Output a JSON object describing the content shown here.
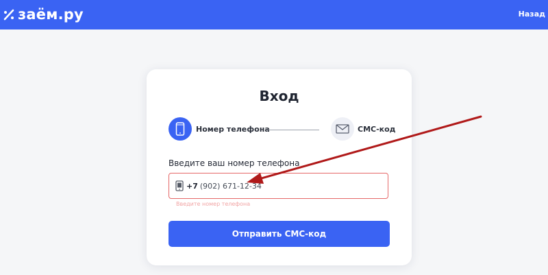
{
  "header": {
    "logo_text": "заём.ру",
    "back_label": "Назад"
  },
  "colors": {
    "brand": "#3a63f3",
    "error": "#e56767",
    "annotation_arrow": "#b01919"
  },
  "card": {
    "title": "Вход",
    "steps": [
      {
        "label": "Номер телефона",
        "icon": "phone-icon",
        "active": true
      },
      {
        "label": "СМС-код",
        "icon": "envelope-icon",
        "active": false
      }
    ],
    "field_label": "Введите ваш номер телефона",
    "phone": {
      "prefix": "+7",
      "value": "(902) 671-12-34"
    },
    "error_text": "Введите номер телефона",
    "submit_label": "Отправить СМС-код"
  }
}
